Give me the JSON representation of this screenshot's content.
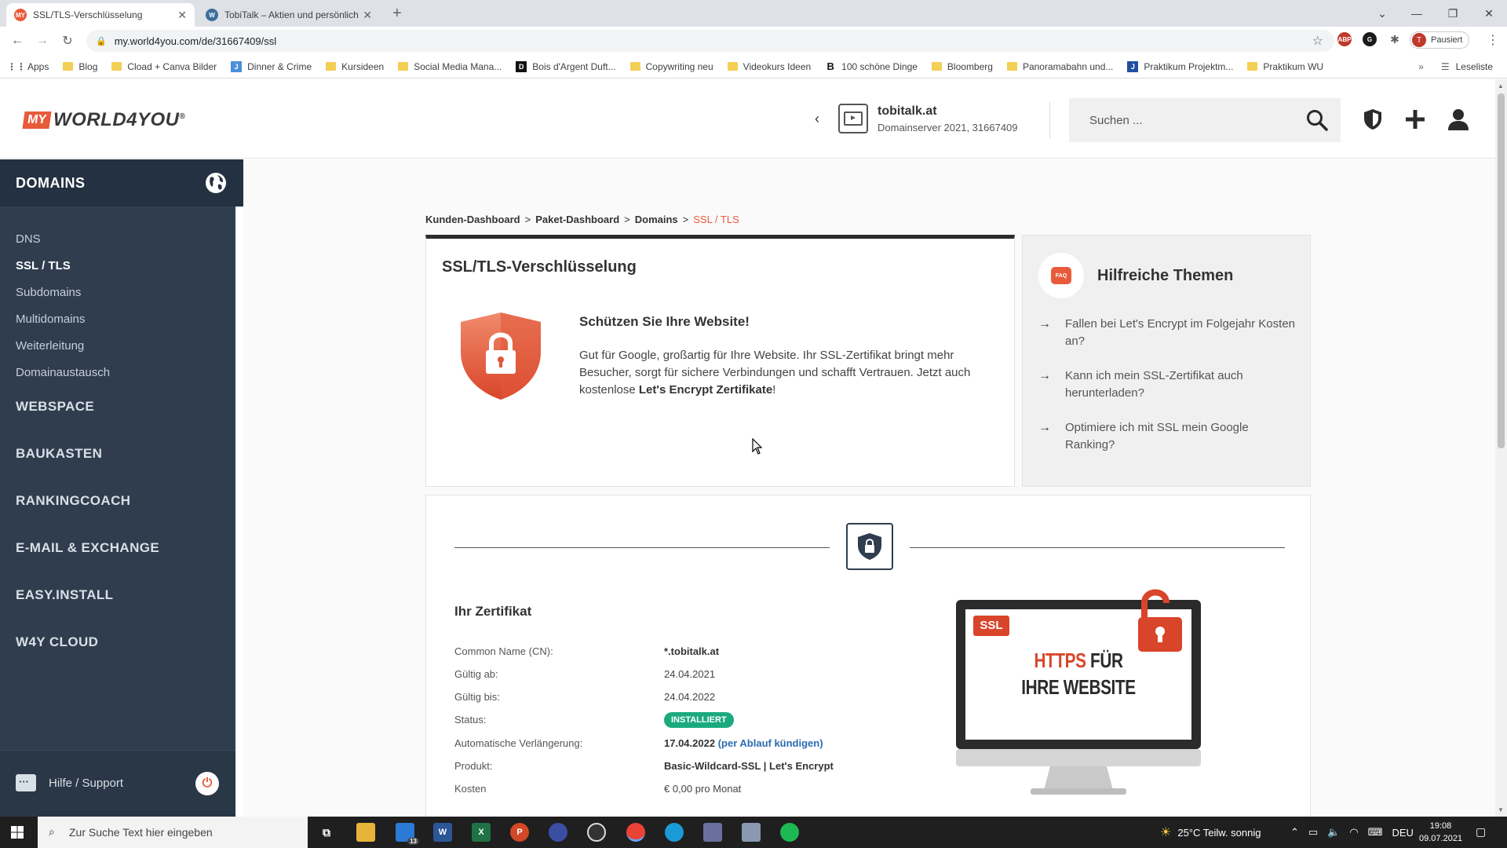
{
  "browser": {
    "tabs": [
      {
        "title": "SSL/TLS-Verschlüsselung",
        "favicon": "MY"
      },
      {
        "title": "TobiTalk – Aktien und persönliche",
        "favicon": "W"
      }
    ],
    "url": "my.world4you.com/de/31667409/ssl",
    "profile_label": "Pausiert",
    "profile_initial": "T",
    "bookmarks": [
      "Apps",
      "Blog",
      "Cload + Canva Bilder",
      "Dinner & Crime",
      "Kursideen",
      "Social Media Mana...",
      "Bois d'Argent Duft...",
      "Copywriting neu",
      "Videokurs Ideen",
      "100 schöne Dinge",
      "Bloomberg",
      "Panoramabahn und...",
      "Praktikum Projektm...",
      "Praktikum WU"
    ],
    "reading_list": "Leseliste"
  },
  "header": {
    "logo_my": "MY",
    "logo_text": "WORLD4YOU",
    "logo_reg": "®",
    "server_name": "tobitalk.at",
    "server_sub": "Domainserver 2021, 31667409",
    "search_placeholder": "Suchen ..."
  },
  "sidebar": {
    "active_section": "DOMAINS",
    "sub_items": [
      "DNS",
      "SSL / TLS",
      "Subdomains",
      "Multidomains",
      "Weiterleitung",
      "Domainaustausch"
    ],
    "sections": [
      "WEBSPACE",
      "BAUKASTEN",
      "RANKINGCOACH",
      "E-MAIL & EXCHANGE",
      "EASY.INSTALL",
      "W4Y CLOUD"
    ],
    "help": "Hilfe / Support"
  },
  "breadcrumb": [
    "Kunden-Dashboard",
    "Paket-Dashboard",
    "Domains",
    "SSL / TLS"
  ],
  "intro": {
    "title": "SSL/TLS-Verschlüsselung",
    "subtitle": "Schützen Sie Ihre Website!",
    "text": "Gut für Google, großartig für Ihre Website. Ihr SSL-Zertifikat bringt mehr Besucher, sorgt für sichere Verbindungen und schafft Vertrauen. Jetzt auch kostenlose",
    "text_bold": "Let's Encrypt Zertifikate",
    "text_end": "!"
  },
  "help_topics": {
    "title": "Hilfreiche Themen",
    "faq_badge": "FAQ",
    "items": [
      "Fallen bei Let's Encrypt im Folgejahr Kosten an?",
      "Kann ich mein SSL-Zertifikat auch herunterladen?",
      "Optimiere ich mit SSL mein Google Ranking?"
    ]
  },
  "certificate": {
    "title": "Ihr Zertifikat",
    "rows": [
      {
        "label": "Common Name (CN):",
        "value": "*.tobitalk.at"
      },
      {
        "label": "Gültig ab:",
        "value": "24.04.2021"
      },
      {
        "label": "Gültig bis:",
        "value": "24.04.2022"
      },
      {
        "label": "Status:",
        "value": "INSTALLIERT"
      },
      {
        "label": "Automatische Verlängerung:",
        "value": "17.04.2022",
        "link": "(per Ablauf kündigen)"
      },
      {
        "label": "Produkt:",
        "value": "Basic-Wildcard-SSL | Let's Encrypt"
      },
      {
        "label": "Kosten",
        "value": "€ 0,00 pro Monat"
      }
    ],
    "illustration": {
      "badge": "SSL",
      "line1_red": "HTTPS",
      "line1_dark": "FÜR",
      "line2": "IHRE WEBSITE"
    }
  },
  "taskbar": {
    "search_placeholder": "Zur Suche Text hier eingeben",
    "weather": "25°C  Teilw. sonnig",
    "lang": "DEU",
    "time": "19:08",
    "date": "09.07.2021",
    "mail_badge": "13"
  },
  "colors": {
    "accent": "#e85b3a",
    "sidebar": "#2f3d4f",
    "status_green": "#1aaa7d"
  }
}
